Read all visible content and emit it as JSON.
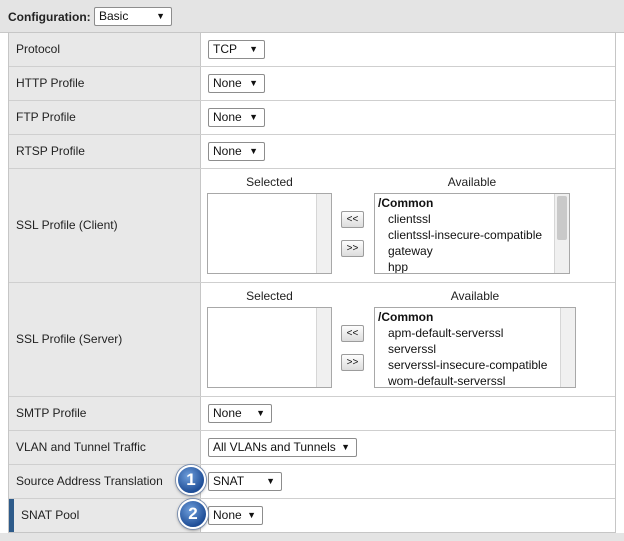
{
  "configuration": {
    "label": "Configuration:",
    "value": "Basic"
  },
  "rows": {
    "protocol": {
      "label": "Protocol",
      "value": "TCP"
    },
    "http_profile": {
      "label": "HTTP Profile",
      "value": "None"
    },
    "ftp_profile": {
      "label": "FTP Profile",
      "value": "None"
    },
    "rtsp_profile": {
      "label": "RTSP Profile",
      "value": "None"
    },
    "ssl_client": {
      "label": "SSL Profile (Client)",
      "selected_header": "Selected",
      "available_header": "Available",
      "move_left": "<<",
      "move_right": ">>",
      "available_group": "/Common",
      "available_items": [
        "clientssl",
        "clientssl-insecure-compatible",
        "gateway",
        "hpp"
      ]
    },
    "ssl_server": {
      "label": "SSL Profile (Server)",
      "selected_header": "Selected",
      "available_header": "Available",
      "move_left": "<<",
      "move_right": ">>",
      "available_group": "/Common",
      "available_items": [
        "apm-default-serverssl",
        "serverssl",
        "serverssl-insecure-compatible",
        "wom-default-serverssl"
      ]
    },
    "smtp_profile": {
      "label": "SMTP Profile",
      "value": "None"
    },
    "vlan_tunnel": {
      "label": "VLAN and Tunnel Traffic",
      "value": "All VLANs and Tunnels"
    },
    "source_translation": {
      "label": "Source Address Translation",
      "value": "SNAT",
      "callout": "1"
    },
    "snat_pool": {
      "label": "SNAT Pool",
      "value": "None",
      "callout": "2"
    }
  },
  "colors": {
    "label_bg": "#e8e8e8",
    "accent": "#2e5b8a",
    "badge": "#1f4e97"
  }
}
